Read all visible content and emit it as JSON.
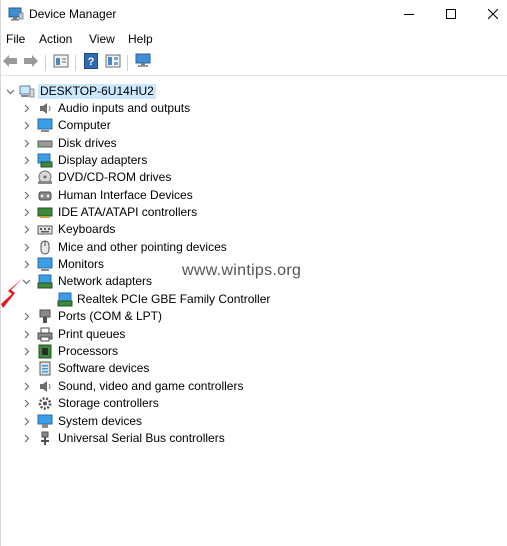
{
  "window": {
    "title": "Device Manager",
    "minimize_icon": "minimize-icon",
    "maximize_icon": "maximize-icon",
    "close_icon": "close-icon"
  },
  "menu": {
    "items": [
      "File",
      "Action",
      "View",
      "Help"
    ]
  },
  "toolbar": {
    "buttons": [
      "back-arrow-icon",
      "forward-arrow-icon",
      "properties-icon",
      "help-icon",
      "view-icon",
      "monitor-icon"
    ]
  },
  "tree": {
    "root": {
      "label": "DESKTOP-6U14HU2",
      "icon": "computer-icon",
      "expanded": true
    },
    "categories": [
      {
        "label": "Audio inputs and outputs",
        "icon": "speaker-icon",
        "expanded": false
      },
      {
        "label": "Computer",
        "icon": "monitor-icon",
        "expanded": false
      },
      {
        "label": "Disk drives",
        "icon": "disk-drive-icon",
        "expanded": false
      },
      {
        "label": "Display adapters",
        "icon": "display-adapter-icon",
        "expanded": false
      },
      {
        "label": "DVD/CD-ROM drives",
        "icon": "dvd-drive-icon",
        "expanded": false
      },
      {
        "label": "Human Interface Devices",
        "icon": "hid-icon",
        "expanded": false
      },
      {
        "label": "IDE ATA/ATAPI controllers",
        "icon": "ide-controller-icon",
        "expanded": false
      },
      {
        "label": "Keyboards",
        "icon": "keyboard-icon",
        "expanded": false
      },
      {
        "label": "Mice and other pointing devices",
        "icon": "mouse-icon",
        "expanded": false
      },
      {
        "label": "Monitors",
        "icon": "monitor-icon",
        "expanded": false
      },
      {
        "label": "Network adapters",
        "icon": "network-adapter-icon",
        "expanded": true,
        "children": [
          {
            "label": "Realtek PCIe GBE Family Controller",
            "icon": "network-adapter-icon"
          }
        ]
      },
      {
        "label": "Ports (COM & LPT)",
        "icon": "port-icon",
        "expanded": false
      },
      {
        "label": "Print queues",
        "icon": "printer-icon",
        "expanded": false
      },
      {
        "label": "Processors",
        "icon": "processor-icon",
        "expanded": false
      },
      {
        "label": "Software devices",
        "icon": "software-device-icon",
        "expanded": false
      },
      {
        "label": "Sound, video and game controllers",
        "icon": "speaker-icon",
        "expanded": false
      },
      {
        "label": "Storage controllers",
        "icon": "storage-controller-icon",
        "expanded": false
      },
      {
        "label": "System devices",
        "icon": "system-device-icon",
        "expanded": false
      },
      {
        "label": "Universal Serial Bus controllers",
        "icon": "usb-icon",
        "expanded": false
      }
    ]
  },
  "overlay": {
    "watermark": "www.wintips.org",
    "arrow_color": "#e8141b"
  },
  "colors": {
    "selection": "#cce8ff",
    "expander": "#6d6d6d"
  }
}
